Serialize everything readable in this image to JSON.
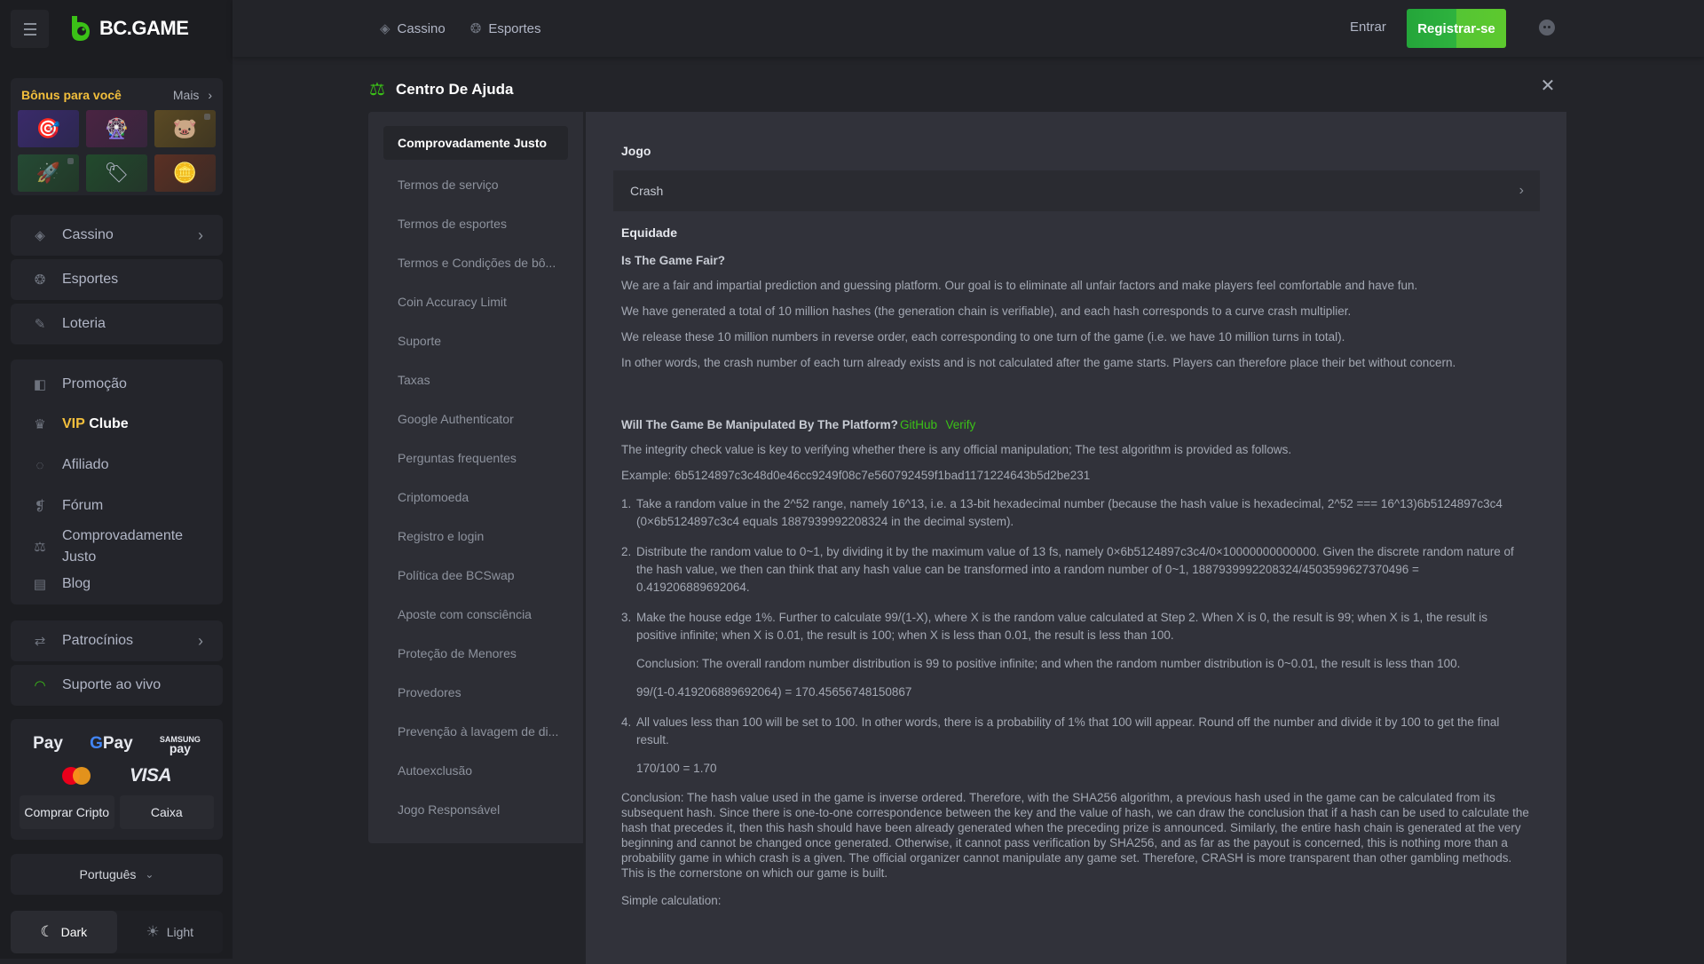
{
  "header": {
    "logo_text": "BC.GAME",
    "nav": [
      {
        "label": "Cassino",
        "icon": "casino-icon"
      },
      {
        "label": "Esportes",
        "icon": "sports-icon"
      }
    ],
    "login_label": "Entrar",
    "register_label": "Registrar-se",
    "accent_color": "#3bc117"
  },
  "sidebar": {
    "bonus": {
      "title": "Bônus para você",
      "more_label": "Mais",
      "tiles": [
        {
          "icon": "target-icon",
          "glyph": "🎯",
          "locked": false
        },
        {
          "icon": "wheel-icon",
          "glyph": "🎡",
          "locked": false
        },
        {
          "icon": "piggy-bank-icon",
          "glyph": "🐷",
          "locked": true
        },
        {
          "icon": "rocket-icon",
          "glyph": "🚀",
          "locked": true
        },
        {
          "icon": "tags-icon",
          "glyph": "🏷",
          "locked": false
        },
        {
          "icon": "coin-fire-icon",
          "glyph": "🪙",
          "locked": false
        }
      ]
    },
    "main_items": [
      {
        "label": "Cassino",
        "icon": "casino-icon",
        "has_chevron": true
      },
      {
        "label": "Esportes",
        "icon": "sports-icon",
        "has_chevron": false
      },
      {
        "label": "Loteria",
        "icon": "lottery-icon",
        "has_chevron": false
      }
    ],
    "group_items": [
      {
        "label": "Promoção",
        "icon": "promotion-icon"
      },
      {
        "label_vip": "VIP",
        "label": "Clube",
        "icon": "crown-icon"
      },
      {
        "label": "Afiliado",
        "icon": "affiliate-icon"
      },
      {
        "label": "Fórum",
        "icon": "forum-icon"
      },
      {
        "label": "Comprovadamente Justo",
        "icon": "fairness-icon"
      },
      {
        "label": "Blog",
        "icon": "blog-icon"
      }
    ],
    "sponsorships": {
      "label": "Patrocínios",
      "icon": "handshake-icon"
    },
    "live_support": {
      "label": "Suporte ao vivo",
      "icon": "headset-icon",
      "icon_color": "#3bc117"
    },
    "payments": {
      "methods": [
        "Apple Pay",
        "Google Pay",
        "Samsung Pay",
        "Mastercard",
        "VISA"
      ],
      "apple_pay": "Pay",
      "google_pay": "Pay",
      "samsung_top": "SAMSUNG",
      "samsung_bottom": "pay",
      "visa": "VISA",
      "buy_crypto_label": "Comprar Cripto",
      "cashier_label": "Caixa"
    },
    "language": "Português",
    "theme": {
      "dark_label": "Dark",
      "light_label": "Light",
      "selected": "Dark"
    }
  },
  "help": {
    "title": "Centro De Ajuda",
    "nav_items": [
      {
        "label": "Comprovadamente Justo",
        "active": true
      },
      {
        "label": "Termos de serviço"
      },
      {
        "label": "Termos de esportes"
      },
      {
        "label": "Termos e Condições de bô..."
      },
      {
        "label": "Coin Accuracy Limit"
      },
      {
        "label": "Suporte"
      },
      {
        "label": "Taxas"
      },
      {
        "label": "Google Authenticator"
      },
      {
        "label": "Perguntas frequentes"
      },
      {
        "label": "Criptomoeda"
      },
      {
        "label": "Registro e login"
      },
      {
        "label": "Política dee BCSwap"
      },
      {
        "label": "Aposte com consciência"
      },
      {
        "label": "Proteção de Menores"
      },
      {
        "label": "Provedores"
      },
      {
        "label": "Prevenção à lavagem de di..."
      },
      {
        "label": "Autoexclusão"
      },
      {
        "label": "Jogo Responsável"
      }
    ],
    "content": {
      "game_label": "Jogo",
      "game_selected": "Crash",
      "fairness_heading": "Equidade",
      "q1": "Is The Game Fair?",
      "q1_paragraphs": [
        "We are a fair and impartial prediction and guessing platform. Our goal is to eliminate all unfair factors and make players feel comfortable and have fun.",
        "We have generated a total of 10 million hashes (the generation chain is verifiable), and each hash corresponds to a curve crash multiplier.",
        "We release these 10 million numbers in reverse order, each corresponding to one turn of the game (i.e. we have 10 million turns in total).",
        "In other words, the crash number of each turn already exists and is not calculated after the game starts. Players can therefore place their bet without concern."
      ],
      "q2": "Will The Game Be Manipulated By The Platform?",
      "q2_links": [
        "GitHub",
        "Verify"
      ],
      "q2_intro": "The integrity check value is key to verifying whether there is any official manipulation; The test algorithm is provided as follows.",
      "example": "Example: 6b5124897c3c48d0e46cc9249f08c7e560792459f1bad1171224643b5d2be231",
      "steps": [
        {
          "num": "1.",
          "text": "Take a random value in the 2^52 range, namely 16^13, i.e. a 13-bit hexadecimal number (because the hash value is hexadecimal, 2^52 === 16^13)6b5124897c3c4 (0×6b5124897c3c4 equals 1887939992208324 in the decimal system)."
        },
        {
          "num": "2.",
          "text": "Distribute the random value to 0~1, by dividing it by the maximum value of 13 fs, namely 0×6b5124897c3c4/0×10000000000000. Given the discrete random nature of the hash value, we then can think that any hash value can be transformed into a random number of 0~1, 1887939992208324/4503599627370496 = 0.419206889692064."
        },
        {
          "num": "3.",
          "text": "Make the house edge 1%. Further to calculate 99/(1-X), where X is the random value calculated at Step 2. When X is 0, the result is 99; when X is 1, the result is positive infinite; when X is 0.01, the result is 100; when X is less than 0.01, the result is less than 100.",
          "conclusion": "Conclusion: The overall random number distribution is 99 to positive infinite; and when the random number distribution is 0~0.01, the result is less than 100.",
          "formula": "99/(1-0.419206889692064) = 170.45656748150867"
        },
        {
          "num": "4.",
          "text": "All values less than 100 will be set to 100. In other words, there is a probability of 1% that 100 will appear. Round off the number and divide it by 100 to get the final result.",
          "formula": "170/100 = 1.70"
        }
      ],
      "final_conclusion": "Conclusion: The hash value used in the game is inverse ordered. Therefore, with the SHA256 algorithm, a previous hash used in the game can be calculated from its subsequent hash. Since there is one-to-one correspondence between the key and the value of hash, we can draw the conclusion that if a hash can be used to calculate the hash that precedes it, then this hash should have been already generated when the preceding prize is announced. Similarly, the entire hash chain is generated at the very beginning and cannot be changed once generated. Otherwise, it cannot pass verification by SHA256, and as far as the payout is concerned, this is nothing more than a probability game in which crash is a given. The official organizer cannot manipulate any game set. Therefore, CRASH is more transparent than other gambling methods. This is the cornerstone on which our game is built.",
      "simple_calc_label": "Simple calculation:"
    }
  }
}
